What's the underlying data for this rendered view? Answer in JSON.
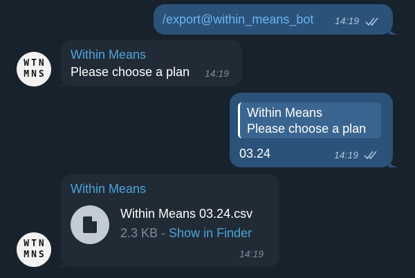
{
  "messages": {
    "cmd": {
      "text": "/export@within_means_bot",
      "time": "14:19"
    },
    "plan": {
      "sender": "Within Means",
      "text": "Please choose a plan",
      "time": "14:19"
    },
    "reply": {
      "quote_sender": "Within Means",
      "quote_text": "Please choose a plan",
      "text": "03.24",
      "time": "14:19"
    },
    "file": {
      "sender": "Within Means",
      "file_name": "Within Means 03.24.csv",
      "file_size": "2.3 KB",
      "separator": " - ",
      "finder_label": "Show in Finder",
      "time": "14:19",
      "icon": "document-icon"
    }
  },
  "avatar": {
    "line1": "WTN",
    "line2": "MNS"
  },
  "colors": {
    "background": "#18222d",
    "outgoing": "#2b5278",
    "incoming": "#202b36",
    "accent": "#4ea4d9"
  }
}
